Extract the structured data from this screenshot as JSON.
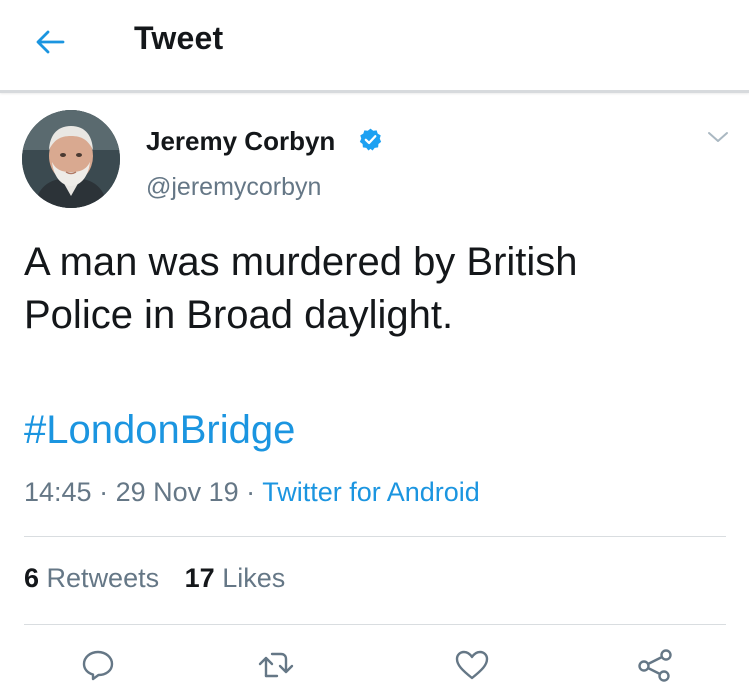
{
  "header": {
    "title": "Tweet"
  },
  "tweet": {
    "author_name": "Jeremy Corbyn",
    "handle": "@jeremycorbyn",
    "text_lines": [
      "A man was murdered by British",
      "Police in Broad daylight."
    ],
    "hashtag": "#LondonBridge",
    "time": "14:45",
    "separator": " · ",
    "date": "29 Nov 19",
    "source": "Twitter for Android",
    "retweets_count": "6",
    "retweets_label": "Retweets",
    "likes_count": "17",
    "likes_label": "Likes"
  },
  "colors": {
    "accent": "#1b95e0",
    "secondary_text": "#657786",
    "primary_text": "#14171a",
    "divider": "#d9dde0"
  },
  "icons": [
    "back-arrow-icon",
    "verified-badge-icon",
    "chevron-down-icon",
    "reply-icon",
    "retweet-icon",
    "like-icon",
    "share-icon"
  ]
}
